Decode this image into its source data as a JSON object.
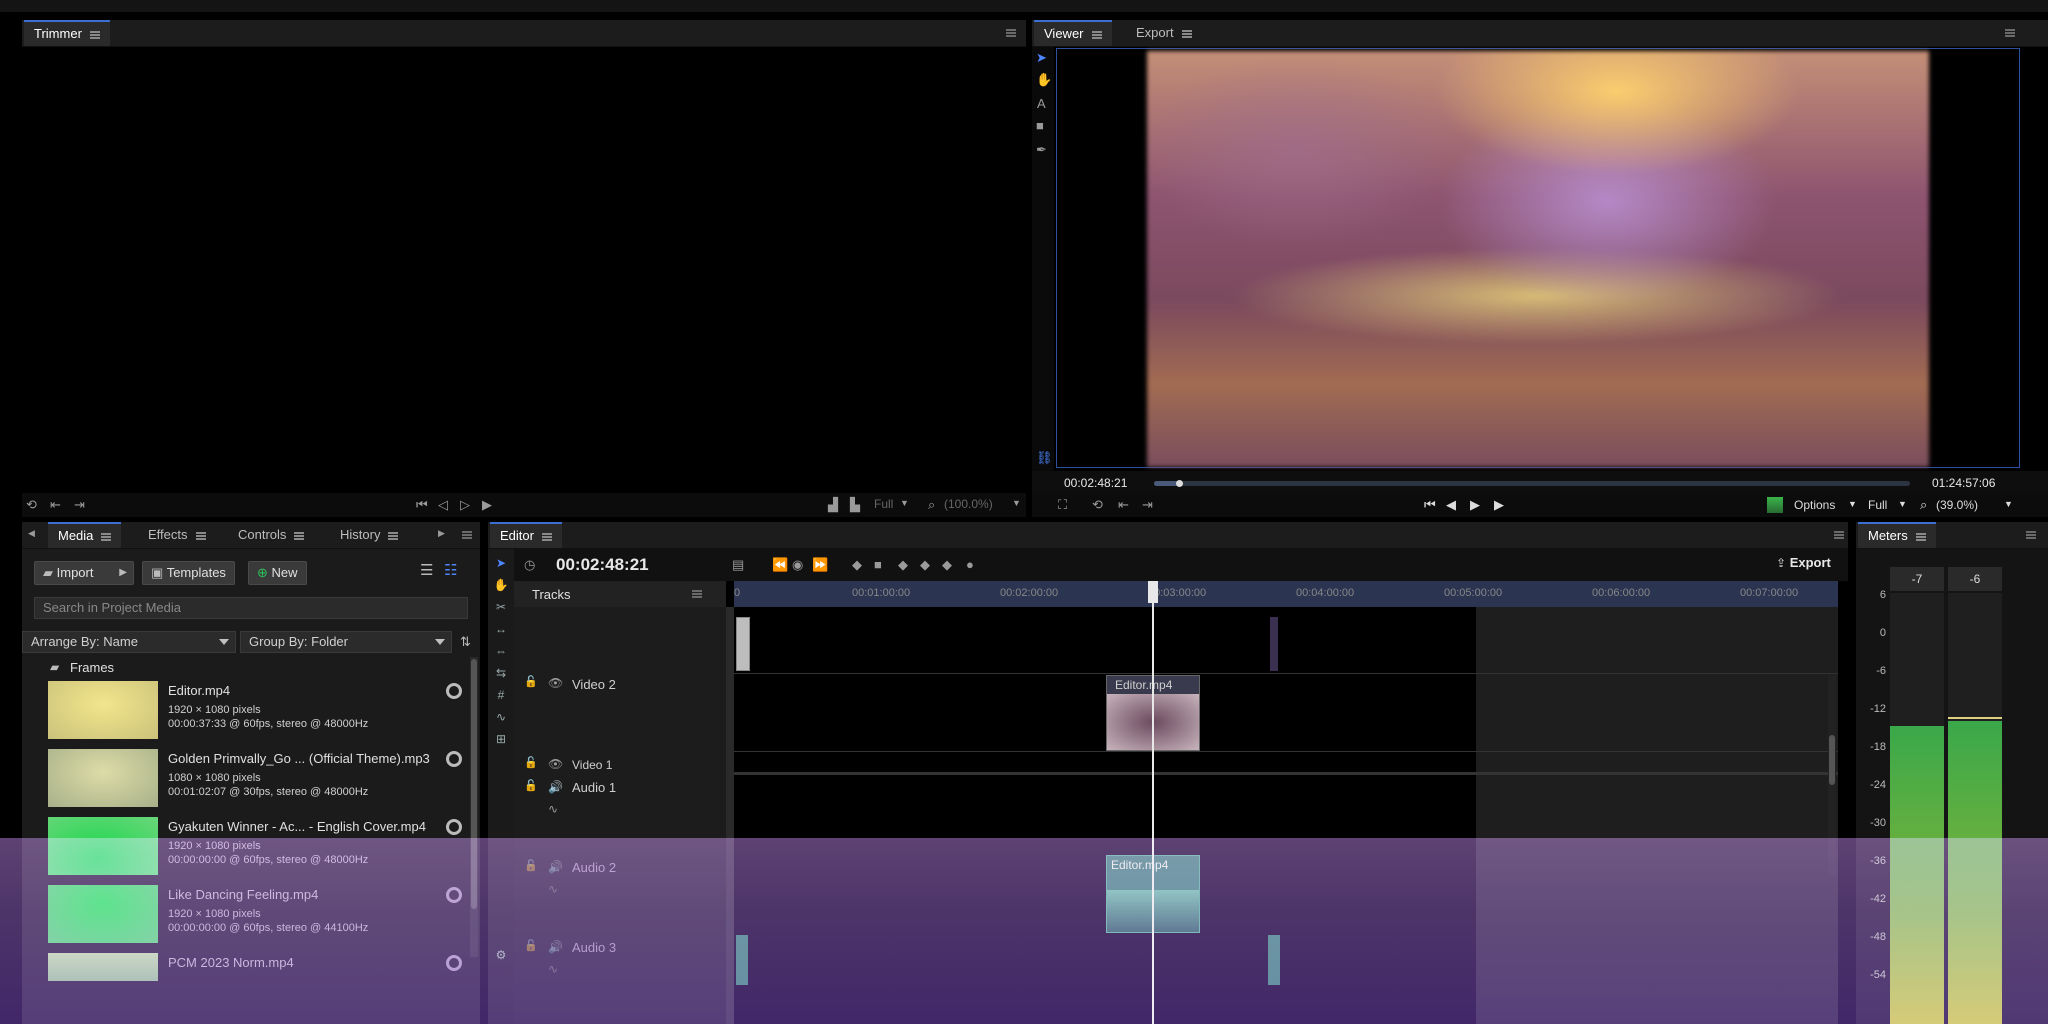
{
  "trimmer": {
    "tab_label": "Trimmer"
  },
  "viewer": {
    "tab_viewer": "Viewer",
    "tab_export": "Export",
    "current_time": "00:02:48:21",
    "end_time": "01:24:57:06",
    "options_label": "Options",
    "quality_label": "Full",
    "zoom_label": "(39.0%)",
    "progress_fraction": 0.033
  },
  "trimmer_controls": {
    "quality_label": "Full",
    "zoom_label": "(100.0%)"
  },
  "media_panel": {
    "tabs": [
      "Media",
      "Effects",
      "Controls",
      "History"
    ],
    "import_label": "Import",
    "templates_label": "Templates",
    "new_label": "New",
    "search_placeholder": "Search in Project Media",
    "arrange_by": "Arrange By: Name",
    "group_by": "Group By: Folder",
    "folder_name": "Frames",
    "items": [
      {
        "name": "Editor.mp4",
        "line2": "1920 × 1080 pixels",
        "line3": "00:00:37:33 @ 60fps, stereo @ 48000Hz"
      },
      {
        "name": "Golden Primvally_Go ... (Official Theme).mp3",
        "line2": "1080 × 1080 pixels",
        "line3": "00:01:02:07 @ 30fps, stereo @ 48000Hz"
      },
      {
        "name": "Gyakuten Winner - Ac... - English Cover.mp4",
        "line2": "1920 × 1080 pixels",
        "line3": "00:00:00:00 @ 60fps, stereo @ 48000Hz"
      },
      {
        "name": "Like Dancing Feeling.mp4",
        "line2": "1920 × 1080 pixels",
        "line3": "00:00:00:00 @ 60fps, stereo @ 44100Hz"
      },
      {
        "name": "PCM 2023 Norm.mp4",
        "line2": "",
        "line3": ""
      }
    ]
  },
  "editor": {
    "tab_label": "Editor",
    "timecode": "00:02:48:21",
    "export_label": "Export",
    "tracks_label": "Tracks",
    "ruler": [
      "0",
      "00:01:00:00",
      "00:02:00:00",
      "00:03:00:00",
      "00:04:00:00",
      "00:05:00:00",
      "00:06:00:00",
      "00:07:00:00"
    ],
    "tracks": [
      "Video 2",
      "Video 1",
      "Audio 1",
      "Audio 2",
      "Audio 3"
    ],
    "clip_video2": "Editor.mp4",
    "clip_audio2": "Editor.mp4"
  },
  "meters": {
    "tab_label": "Meters",
    "peak_left": "-7",
    "peak_right": "-6",
    "scale": [
      "6",
      "0",
      "-6",
      "-12",
      "-18",
      "-24",
      "-30",
      "-36",
      "-42",
      "-48",
      "-54"
    ]
  },
  "colors": {
    "accent": "#3d6fd1",
    "ruler_bg": "#3a4a6e",
    "audio_clip": "#2f7a66",
    "meter_top": "#3aa84a",
    "meter_bottom": "#c8c21a",
    "overlay": "#8a5fb0"
  }
}
